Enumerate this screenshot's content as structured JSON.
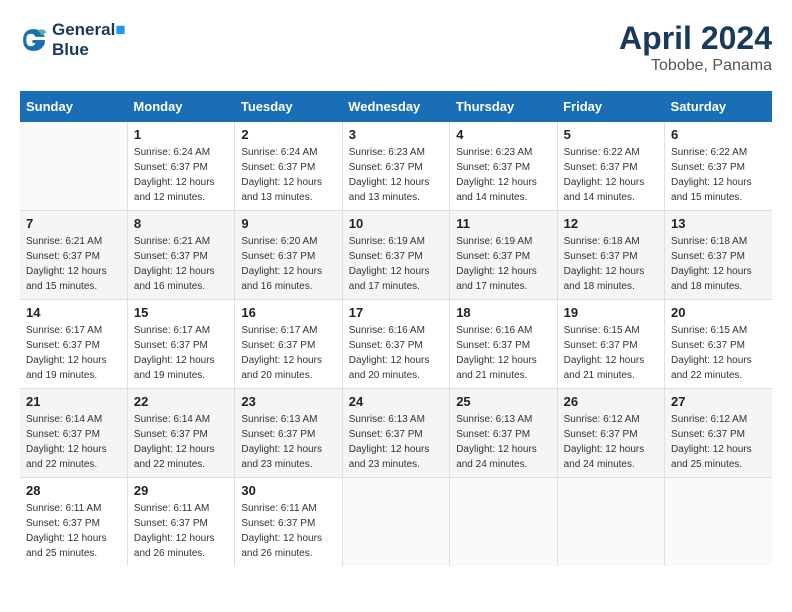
{
  "header": {
    "logo_line1": "General",
    "logo_line2": "Blue",
    "month_year": "April 2024",
    "location": "Tobobe, Panama"
  },
  "days_of_week": [
    "Sunday",
    "Monday",
    "Tuesday",
    "Wednesday",
    "Thursday",
    "Friday",
    "Saturday"
  ],
  "weeks": [
    [
      {
        "num": "",
        "empty": true
      },
      {
        "num": "1",
        "sunrise": "6:24 AM",
        "sunset": "6:37 PM",
        "daylight": "12 hours and 12 minutes."
      },
      {
        "num": "2",
        "sunrise": "6:24 AM",
        "sunset": "6:37 PM",
        "daylight": "12 hours and 13 minutes."
      },
      {
        "num": "3",
        "sunrise": "6:23 AM",
        "sunset": "6:37 PM",
        "daylight": "12 hours and 13 minutes."
      },
      {
        "num": "4",
        "sunrise": "6:23 AM",
        "sunset": "6:37 PM",
        "daylight": "12 hours and 14 minutes."
      },
      {
        "num": "5",
        "sunrise": "6:22 AM",
        "sunset": "6:37 PM",
        "daylight": "12 hours and 14 minutes."
      },
      {
        "num": "6",
        "sunrise": "6:22 AM",
        "sunset": "6:37 PM",
        "daylight": "12 hours and 15 minutes."
      }
    ],
    [
      {
        "num": "7",
        "sunrise": "6:21 AM",
        "sunset": "6:37 PM",
        "daylight": "12 hours and 15 minutes."
      },
      {
        "num": "8",
        "sunrise": "6:21 AM",
        "sunset": "6:37 PM",
        "daylight": "12 hours and 16 minutes."
      },
      {
        "num": "9",
        "sunrise": "6:20 AM",
        "sunset": "6:37 PM",
        "daylight": "12 hours and 16 minutes."
      },
      {
        "num": "10",
        "sunrise": "6:19 AM",
        "sunset": "6:37 PM",
        "daylight": "12 hours and 17 minutes."
      },
      {
        "num": "11",
        "sunrise": "6:19 AM",
        "sunset": "6:37 PM",
        "daylight": "12 hours and 17 minutes."
      },
      {
        "num": "12",
        "sunrise": "6:18 AM",
        "sunset": "6:37 PM",
        "daylight": "12 hours and 18 minutes."
      },
      {
        "num": "13",
        "sunrise": "6:18 AM",
        "sunset": "6:37 PM",
        "daylight": "12 hours and 18 minutes."
      }
    ],
    [
      {
        "num": "14",
        "sunrise": "6:17 AM",
        "sunset": "6:37 PM",
        "daylight": "12 hours and 19 minutes."
      },
      {
        "num": "15",
        "sunrise": "6:17 AM",
        "sunset": "6:37 PM",
        "daylight": "12 hours and 19 minutes."
      },
      {
        "num": "16",
        "sunrise": "6:17 AM",
        "sunset": "6:37 PM",
        "daylight": "12 hours and 20 minutes."
      },
      {
        "num": "17",
        "sunrise": "6:16 AM",
        "sunset": "6:37 PM",
        "daylight": "12 hours and 20 minutes."
      },
      {
        "num": "18",
        "sunrise": "6:16 AM",
        "sunset": "6:37 PM",
        "daylight": "12 hours and 21 minutes."
      },
      {
        "num": "19",
        "sunrise": "6:15 AM",
        "sunset": "6:37 PM",
        "daylight": "12 hours and 21 minutes."
      },
      {
        "num": "20",
        "sunrise": "6:15 AM",
        "sunset": "6:37 PM",
        "daylight": "12 hours and 22 minutes."
      }
    ],
    [
      {
        "num": "21",
        "sunrise": "6:14 AM",
        "sunset": "6:37 PM",
        "daylight": "12 hours and 22 minutes."
      },
      {
        "num": "22",
        "sunrise": "6:14 AM",
        "sunset": "6:37 PM",
        "daylight": "12 hours and 22 minutes."
      },
      {
        "num": "23",
        "sunrise": "6:13 AM",
        "sunset": "6:37 PM",
        "daylight": "12 hours and 23 minutes."
      },
      {
        "num": "24",
        "sunrise": "6:13 AM",
        "sunset": "6:37 PM",
        "daylight": "12 hours and 23 minutes."
      },
      {
        "num": "25",
        "sunrise": "6:13 AM",
        "sunset": "6:37 PM",
        "daylight": "12 hours and 24 minutes."
      },
      {
        "num": "26",
        "sunrise": "6:12 AM",
        "sunset": "6:37 PM",
        "daylight": "12 hours and 24 minutes."
      },
      {
        "num": "27",
        "sunrise": "6:12 AM",
        "sunset": "6:37 PM",
        "daylight": "12 hours and 25 minutes."
      }
    ],
    [
      {
        "num": "28",
        "sunrise": "6:11 AM",
        "sunset": "6:37 PM",
        "daylight": "12 hours and 25 minutes."
      },
      {
        "num": "29",
        "sunrise": "6:11 AM",
        "sunset": "6:37 PM",
        "daylight": "12 hours and 26 minutes."
      },
      {
        "num": "30",
        "sunrise": "6:11 AM",
        "sunset": "6:37 PM",
        "daylight": "12 hours and 26 minutes."
      },
      {
        "num": "",
        "empty": true
      },
      {
        "num": "",
        "empty": true
      },
      {
        "num": "",
        "empty": true
      },
      {
        "num": "",
        "empty": true
      }
    ]
  ],
  "labels": {
    "sunrise": "Sunrise:",
    "sunset": "Sunset:",
    "daylight": "Daylight:"
  }
}
